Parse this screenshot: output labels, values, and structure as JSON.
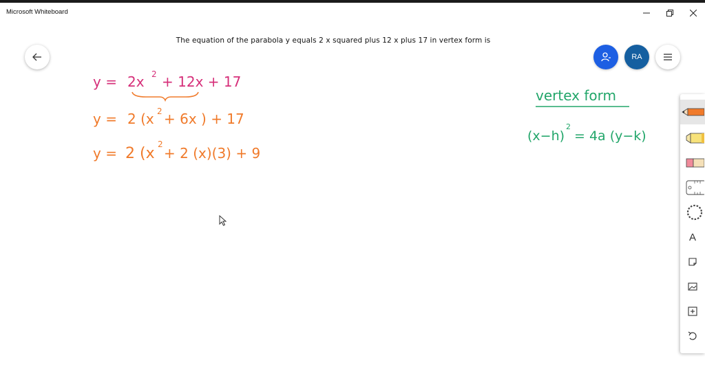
{
  "window": {
    "app_title": "Microsoft Whiteboard"
  },
  "board": {
    "title": "The equation of the parabola y equals 2 x squared plus 12 x plus 17 in vertex form is"
  },
  "header": {
    "avatar_initials": "RA",
    "share_color": "#1d5fe3",
    "avatar_color": "#155fa0"
  },
  "ink": {
    "colors": {
      "magenta": "#d6307a",
      "orange": "#f07a2a",
      "green": "#22a66a"
    },
    "line1": {
      "lhs": "y =",
      "term1": "2x",
      "exp": "2",
      "rest": "+ 12x + 17"
    },
    "line2": {
      "lhs": "y =",
      "text": "2 (x",
      "exp": "2",
      "rest": "+ 6x )  + 17"
    },
    "line3": {
      "lhs": "y =",
      "text": "2 (x",
      "exp": "2",
      "rest": "+ 2 (x)(3)  + 9"
    },
    "note_title": "vertex form",
    "note_formula": {
      "lhs": "(x−h)",
      "exp": "2",
      "rhs": "= 4a (y−k)"
    }
  },
  "toolbar": {
    "tools": [
      "pen-tool",
      "highlighter-tool",
      "eraser-tool",
      "ruler-tool",
      "lasso-tool",
      "text-tool",
      "sticky-note-tool",
      "image-tool",
      "add-tool",
      "undo-tool"
    ],
    "text_tool_glyph": "A"
  }
}
